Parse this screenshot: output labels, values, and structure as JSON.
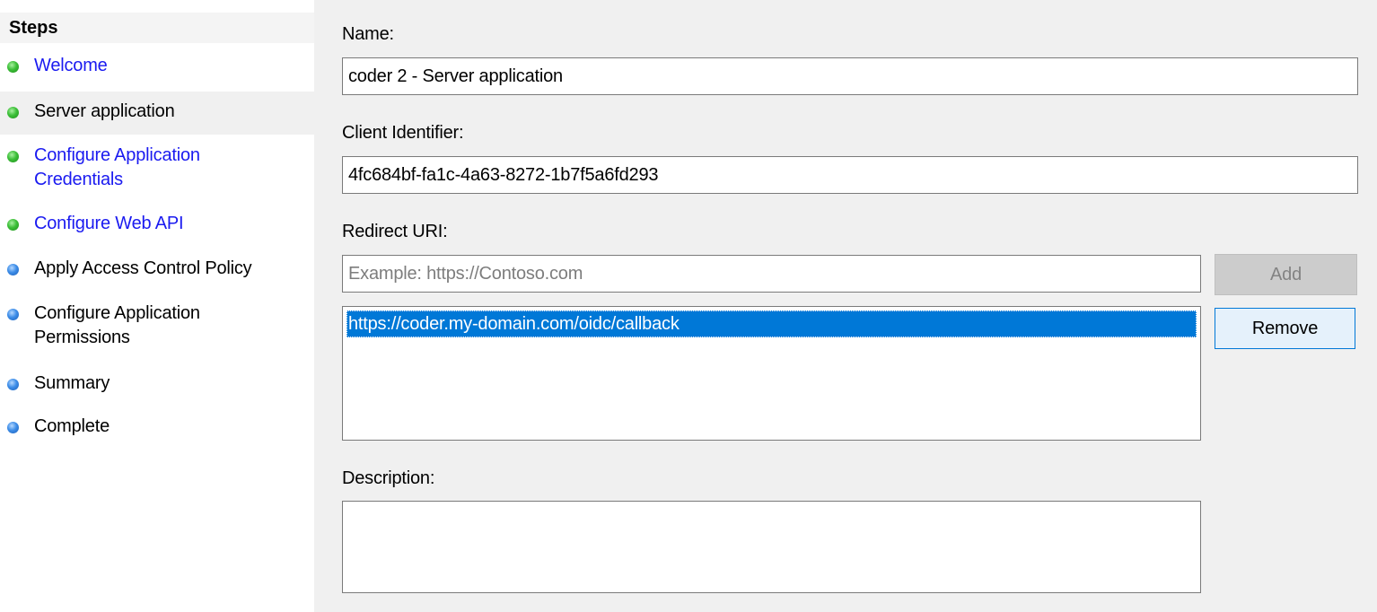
{
  "sidebar": {
    "header": "Steps",
    "steps": [
      {
        "label": "Welcome",
        "status": "green",
        "style": "link"
      },
      {
        "label": "Server application",
        "status": "green",
        "style": "plain",
        "selected": true
      },
      {
        "label": "Configure Application Credentials",
        "label_lines": [
          "Configure Application",
          "Credentials"
        ],
        "status": "green",
        "style": "link"
      },
      {
        "label": "Configure Web API",
        "status": "green",
        "style": "link"
      },
      {
        "label": "Apply Access Control Policy",
        "status": "blue",
        "style": "plain"
      },
      {
        "label": "Configure Application Permissions",
        "label_lines": [
          "Configure Application",
          "Permissions"
        ],
        "status": "blue",
        "style": "plain"
      },
      {
        "label": "Summary",
        "status": "blue",
        "style": "plain"
      },
      {
        "label": "Complete",
        "status": "blue",
        "style": "plain"
      }
    ]
  },
  "form": {
    "name_label": "Name:",
    "name_value": "coder 2 - Server application",
    "client_id_label": "Client Identifier:",
    "client_id_value": "4fc684bf-fa1c-4a63-8272-1b7f5a6fd293",
    "redirect_label": "Redirect URI:",
    "redirect_placeholder": "Example: https://Contoso.com",
    "add_button": "Add",
    "remove_button": "Remove",
    "redirect_uris": [
      "https://coder.my-domain.com/oidc/callback"
    ],
    "description_label": "Description:",
    "description_value": ""
  },
  "colors": {
    "link": "#1a1af0",
    "selection": "#0078d7",
    "step_complete": "#3cbf38",
    "step_pending": "#3d8de8"
  }
}
